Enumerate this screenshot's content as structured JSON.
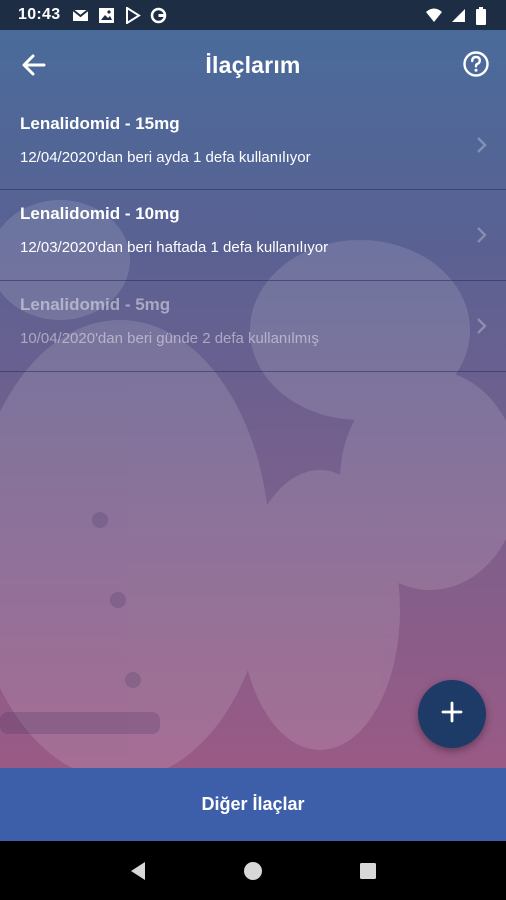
{
  "status_bar": {
    "time": "10:43",
    "icons": [
      "gmail-icon",
      "photo-icon",
      "play-store-icon",
      "app-icon"
    ],
    "right_icons": [
      "wifi-icon",
      "signal-icon",
      "battery-icon"
    ]
  },
  "app_bar": {
    "title": "İlaçlarım",
    "back_icon": "arrow-left-icon",
    "help_icon": "help-circle-icon"
  },
  "medications": [
    {
      "name": "Lenalidomid - 15mg",
      "description": "12/04/2020'dan beri ayda 1 defa kullanılıyor",
      "active": true
    },
    {
      "name": "Lenalidomid - 10mg",
      "description": "12/03/2020'dan beri haftada 1 defa kullanılıyor",
      "active": true
    },
    {
      "name": "Lenalidomid - 5mg",
      "description": "10/04/2020'dan beri günde 2 defa kullanılmış",
      "active": false
    }
  ],
  "fab": {
    "icon": "plus-icon"
  },
  "bottom_button": {
    "label": "Diğer İlaçlar"
  },
  "colors": {
    "status_bar": "#1d2d44",
    "fab": "#1d3b66",
    "bottom_button": "#3d5ea8",
    "gradient_top": "#496b9b",
    "gradient_bottom": "#9a5a86"
  }
}
